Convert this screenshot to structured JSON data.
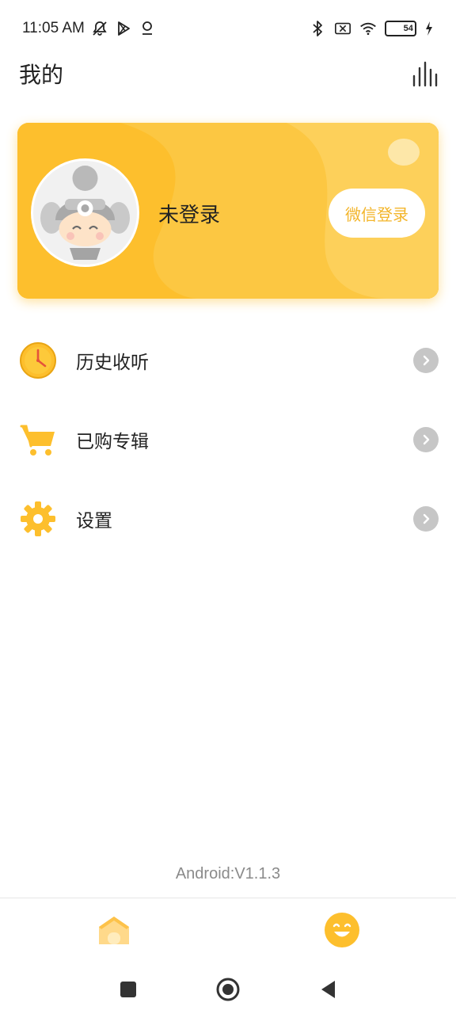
{
  "status_bar": {
    "time": "11:05 AM",
    "battery_level": "54",
    "battery_percent": 54,
    "icons": [
      "muted-notification-icon",
      "play-store-icon",
      "location-icon",
      "bluetooth-icon",
      "no-sim-icon",
      "wifi-icon",
      "battery-icon",
      "charging-icon"
    ]
  },
  "header": {
    "title": "我的",
    "stats_icon": "equalizer-icon"
  },
  "profile": {
    "status": "未登录",
    "login_button": "微信登录",
    "accent": "#fdbf2d"
  },
  "menu": {
    "items": [
      {
        "label": "历史收听",
        "icon": "clock-icon"
      },
      {
        "label": "已购专辑",
        "icon": "cart-icon"
      },
      {
        "label": "设置",
        "icon": "gear-icon"
      }
    ]
  },
  "footer": {
    "version": "Android:V1.1.3"
  },
  "tabs": [
    {
      "icon": "home-icon",
      "active": false
    },
    {
      "icon": "smiley-icon",
      "active": true
    }
  ],
  "nav": [
    "recents-button",
    "home-button",
    "back-button"
  ]
}
